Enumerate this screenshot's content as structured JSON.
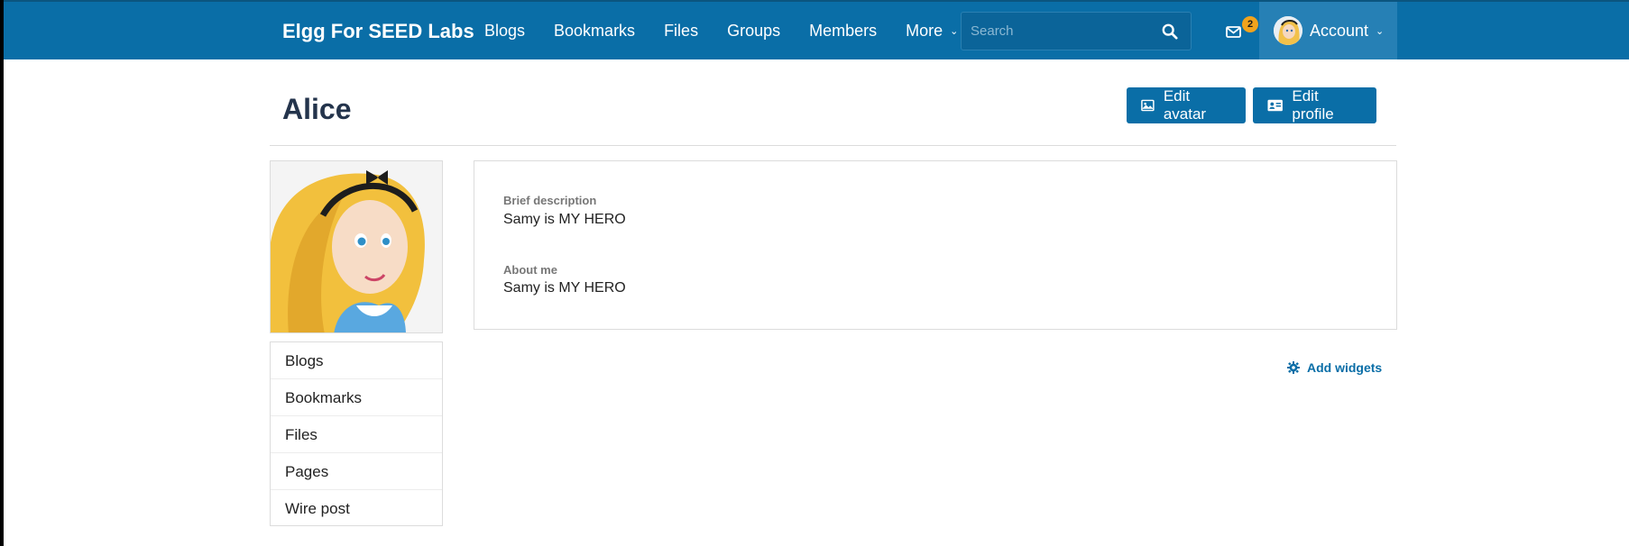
{
  "topbar": {
    "brand": "Elgg For SEED Labs",
    "nav": [
      {
        "label": "Blogs"
      },
      {
        "label": "Bookmarks"
      },
      {
        "label": "Files"
      },
      {
        "label": "Groups"
      },
      {
        "label": "Members"
      },
      {
        "label": "More"
      }
    ],
    "search": {
      "placeholder": "Search",
      "value": ""
    },
    "notifications": {
      "count": "2"
    },
    "account": {
      "label": "Account"
    }
  },
  "page": {
    "title": "Alice",
    "actions": {
      "edit_avatar": "Edit avatar",
      "edit_profile": "Edit profile"
    }
  },
  "profile": {
    "brief_label": "Brief description",
    "brief_value": "Samy is MY HERO",
    "about_label": "About me",
    "about_value": "Samy is MY HERO"
  },
  "sidebar": {
    "items": [
      {
        "label": "Blogs"
      },
      {
        "label": "Bookmarks"
      },
      {
        "label": "Files"
      },
      {
        "label": "Pages"
      },
      {
        "label": "Wire post"
      }
    ]
  },
  "widgets": {
    "add_label": "Add widgets"
  },
  "colors": {
    "topbar": "#0a6ea7",
    "button": "#0a6ea7",
    "badge": "#f0a31d",
    "account_bg": "#2680b5"
  },
  "icons": {
    "search": "search-icon",
    "mail": "envelope-icon",
    "edit_avatar": "image-icon",
    "edit_profile": "id-card-icon",
    "add_widgets": "gear-icon"
  }
}
